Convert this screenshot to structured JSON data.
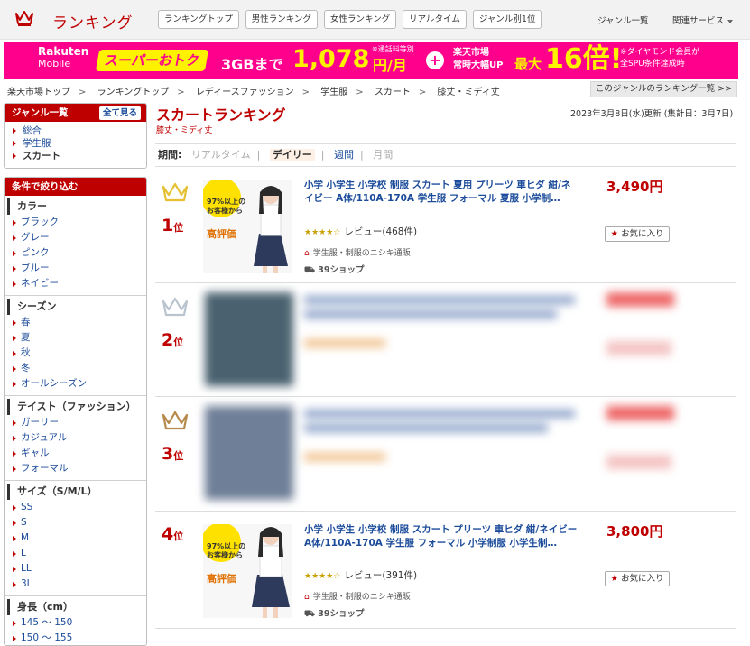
{
  "header": {
    "title": "ランキング",
    "tabs": [
      "ランキングトップ",
      "男性ランキング",
      "女性ランキング",
      "リアルタイム",
      "ジャンル別1位"
    ],
    "genre_list": "ジャンル一覧",
    "related": "関連サービス"
  },
  "banner": {
    "rakuten": "Rakuten",
    "mobile": "Mobile",
    "super": "スーパーおトク",
    "gb": "3GBまで",
    "price": "1,078",
    "unit": "円/月",
    "note1": "※通話料等別",
    "plus": "+",
    "ichiba1": "楽天市場",
    "ichiba2": "常時大幅UP",
    "max": "最大",
    "bai": "16倍!",
    "note2a": "※ダイヤモンド会員が",
    "note2b": "全SPU条件達成時"
  },
  "breadcrumb": [
    "楽天市場トップ",
    "ランキングトップ",
    "レディースファッション",
    "学生服",
    "スカート",
    "膝丈・ミディ丈"
  ],
  "breadcrumb_sep": ">",
  "breadcrumb_button": "このジャンルのランキング一覧 >>",
  "sidebar": {
    "genre_title": "ジャンル一覧",
    "see_all": "全て見る",
    "genres": [
      "総合",
      "学生服",
      "スカート"
    ],
    "filter_title": "条件で絞り込む",
    "sections": [
      {
        "title": "カラー",
        "items": [
          "ブラック",
          "グレー",
          "ピンク",
          "ブルー",
          "ネイビー"
        ]
      },
      {
        "title": "シーズン",
        "items": [
          "春",
          "夏",
          "秋",
          "冬",
          "オールシーズン"
        ]
      },
      {
        "title": "テイスト（ファッション）",
        "items": [
          "ガーリー",
          "カジュアル",
          "ギャル",
          "フォーマル"
        ]
      },
      {
        "title": "サイズ（S/M/L）",
        "items": [
          "SS",
          "S",
          "M",
          "L",
          "LL",
          "3L"
        ]
      },
      {
        "title": "身長（cm）",
        "items": [
          "145 ～ 150",
          "150 ～ 155"
        ]
      }
    ]
  },
  "main": {
    "title": "スカートランキング",
    "subtitle": "膝丈・ミディ丈",
    "date": "2023年3月8日(水)更新 (集計日：3月7日)",
    "period_label": "期間:",
    "periods": [
      "リアルタイム",
      "デイリー",
      "週間",
      "月間"
    ],
    "period_sep": "|"
  },
  "rankings": [
    {
      "rank": "1",
      "suffix": "位",
      "name": "小学 小学生 小学校 制服 スカート 夏用 プリーツ 車ヒダ 紺/ネイビー A体/110A-170A 学生服 フォーマル 夏服 小学制…",
      "price": "3,490円",
      "stars": "★★★★☆",
      "reviews": "レビュー(468件)",
      "shop": "学生服・制服のニシキ通販",
      "shipping": "39ショップ",
      "fav": "お気に入り",
      "thumb_text1": "97%以上の",
      "thumb_text2": "お客様から",
      "thumb_text3": "高評価",
      "crown_color": "#e6c033"
    },
    {
      "rank": "2",
      "suffix": "位",
      "crown_color": "#b9c4cf"
    },
    {
      "rank": "3",
      "suffix": "位",
      "crown_color": "#b58a4a"
    },
    {
      "rank": "4",
      "suffix": "位",
      "name": "小学 小学生 小学校 制服 スカート プリーツ 車ヒダ 紺/ネイビー A体/110A-170A 学生服 フォーマル 小学制服 小学生制…",
      "price": "3,800円",
      "stars": "★★★★☆",
      "reviews": "レビュー(391件)",
      "shop": "学生服・制服のニシキ通販",
      "shipping": "39ショップ",
      "fav": "お気に入り",
      "thumb_text1": "97%以上の",
      "thumb_text2": "お客様から",
      "thumb_text3": "高評価"
    }
  ],
  "colors": {
    "accent": "#bf0000",
    "link": "#1b4b9a",
    "banner": "#ff008c",
    "banner_yellow": "#fff200"
  }
}
